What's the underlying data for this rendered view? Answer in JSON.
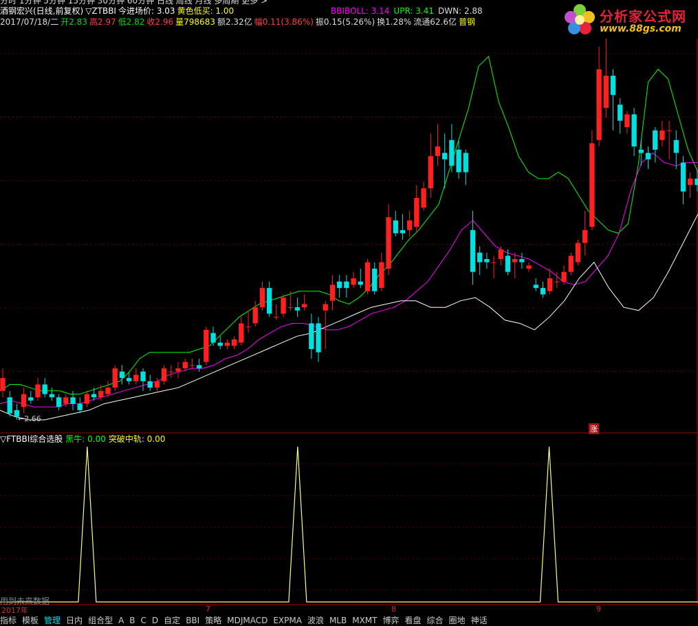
{
  "top_row": {
    "text": "分时 1分钟 5分钟 15分钟 30分钟 60分钟 日线 周线 月线 多周期 更多 >"
  },
  "title_row": [
    {
      "text": "酒钢宏兴(日线,前复权)",
      "color": "#ffffff"
    },
    {
      "text": "▽ZTBBI",
      "color": "#ffffff"
    },
    {
      "text": "今进场价: 3.03",
      "color": "#ffffff"
    },
    {
      "text": "黄色低买: 1.00",
      "color": "#ffff00"
    }
  ],
  "bbi_row": [
    {
      "text": "BBIBOLL: 3.14",
      "color": "#ff00ff"
    },
    {
      "text": "UPR: 3.41",
      "color": "#00ff00"
    },
    {
      "text": "DWN: 2.88",
      "color": "#dddddd"
    }
  ],
  "info_row": [
    {
      "text": "2017/07/18/二",
      "color": "#dddddd"
    },
    {
      "text": "开2.83",
      "color": "#00dd00"
    },
    {
      "text": "高2.97",
      "color": "#ff4040"
    },
    {
      "text": "低2.82",
      "color": "#00dd00"
    },
    {
      "text": "收2.96",
      "color": "#ff4040"
    },
    {
      "text": "量798683",
      "color": "#ffff00"
    },
    {
      "text": "额2.32亿",
      "color": "#dddddd"
    },
    {
      "text": "幅0.11(3.86%)",
      "color": "#ff4040"
    },
    {
      "text": "振0.15(5.26%)",
      "color": "#dddddd"
    },
    {
      "text": "换1.28%",
      "color": "#dddddd"
    },
    {
      "text": "流通62.6亿",
      "color": "#dddddd"
    },
    {
      "text": "普钢",
      "color": "#ffff00"
    }
  ],
  "logo": {
    "brand": "分析家公式网",
    "url": "www.88gs.com"
  },
  "low_marker": "←2.66",
  "zhang_badge": "涨",
  "sub_row": [
    {
      "text": "▽FTBBI综合选股",
      "color": "#ffffff"
    },
    {
      "text": "黑牛: 0.00",
      "color": "#00ff00"
    },
    {
      "text": "突破中轨: 0.00",
      "color": "#ffff00"
    }
  ],
  "future_notice": "用到未来数据",
  "time_axis": [
    "2017年",
    "7",
    "8",
    "9"
  ],
  "bottom_tabs": [
    "指标",
    "模板",
    "管理",
    "日内",
    "组合型",
    "A",
    "B",
    "C",
    "D",
    "自定",
    "BBI",
    "策略",
    "MDJMACD",
    "EXPMA",
    "波浪",
    "MLB",
    "MXMT",
    "博弈",
    "看盘",
    "综合",
    "圈地",
    "神话"
  ],
  "colors": {
    "up": "#ff2020",
    "down": "#00e0e0",
    "upper_band": "#00ff00",
    "mid_band": "#ff00ff",
    "lower_band": "#ffffff",
    "signal": "#ffff80",
    "grid": "#5a0000"
  },
  "chart_data": {
    "type": "candlestick",
    "price_range": [
      2.6,
      3.85
    ],
    "candles": [
      [
        2.72,
        2.76,
        2.79,
        2.7
      ],
      [
        2.7,
        2.65,
        2.72,
        2.64
      ],
      [
        2.66,
        2.64,
        2.68,
        2.63
      ],
      [
        2.67,
        2.71,
        2.73,
        2.65
      ],
      [
        2.7,
        2.69,
        2.72,
        2.68
      ],
      [
        2.7,
        2.74,
        2.76,
        2.69
      ],
      [
        2.74,
        2.71,
        2.76,
        2.7
      ],
      [
        2.71,
        2.7,
        2.73,
        2.69
      ],
      [
        2.7,
        2.67,
        2.71,
        2.66
      ],
      [
        2.68,
        2.7,
        2.71,
        2.67
      ],
      [
        2.7,
        2.68,
        2.72,
        2.66
      ],
      [
        2.68,
        2.66,
        2.7,
        2.65
      ],
      [
        2.68,
        2.71,
        2.72,
        2.67
      ],
      [
        2.71,
        2.7,
        2.73,
        2.69
      ],
      [
        2.7,
        2.72,
        2.74,
        2.69
      ],
      [
        2.71,
        2.73,
        2.75,
        2.7
      ],
      [
        2.73,
        2.79,
        2.8,
        2.72
      ],
      [
        2.78,
        2.76,
        2.8,
        2.74
      ],
      [
        2.76,
        2.75,
        2.78,
        2.74
      ],
      [
        2.75,
        2.77,
        2.79,
        2.74
      ],
      [
        2.78,
        2.75,
        2.79,
        2.72
      ],
      [
        2.75,
        2.73,
        2.77,
        2.72
      ],
      [
        2.73,
        2.75,
        2.76,
        2.72
      ],
      [
        2.75,
        2.79,
        2.8,
        2.74
      ],
      [
        2.78,
        2.78,
        2.8,
        2.76
      ],
      [
        2.78,
        2.79,
        2.81,
        2.76
      ],
      [
        2.79,
        2.81,
        2.82,
        2.78
      ],
      [
        2.8,
        2.8,
        2.82,
        2.79
      ],
      [
        2.8,
        2.79,
        2.82,
        2.78
      ],
      [
        2.81,
        2.91,
        2.92,
        2.8
      ],
      [
        2.9,
        2.87,
        2.92,
        2.86
      ],
      [
        2.87,
        2.86,
        2.89,
        2.85
      ],
      [
        2.86,
        2.87,
        2.88,
        2.85
      ],
      [
        2.86,
        2.88,
        2.89,
        2.85
      ],
      [
        2.87,
        2.93,
        2.95,
        2.86
      ],
      [
        2.92,
        2.92,
        2.97,
        2.9
      ],
      [
        2.93,
        2.98,
        3.0,
        2.92
      ],
      [
        2.98,
        3.04,
        3.06,
        2.97
      ],
      [
        3.04,
        2.96,
        3.06,
        2.95
      ],
      [
        2.95,
        2.95,
        2.99,
        2.94
      ],
      [
        2.96,
        3.01,
        3.02,
        2.95
      ],
      [
        2.98,
        2.98,
        3.03,
        2.97
      ],
      [
        2.98,
        2.97,
        3.01,
        2.95
      ],
      [
        2.98,
        2.99,
        3.02,
        2.97
      ],
      [
        2.93,
        2.85,
        2.96,
        2.82
      ],
      [
        2.93,
        2.84,
        2.95,
        2.81
      ],
      [
        2.97,
        2.99,
        3.0,
        2.85
      ],
      [
        3.0,
        3.05,
        3.08,
        2.97
      ],
      [
        3.06,
        3.04,
        3.08,
        3.01
      ],
      [
        3.06,
        3.04,
        3.08,
        3.01
      ],
      [
        3.05,
        3.07,
        3.09,
        3.04
      ],
      [
        3.06,
        3.05,
        3.1,
        3.04
      ],
      [
        3.03,
        3.12,
        3.13,
        3.02
      ],
      [
        3.1,
        3.03,
        3.12,
        3.02
      ],
      [
        3.04,
        3.12,
        3.15,
        3.03
      ],
      [
        3.1,
        3.26,
        3.3,
        3.08
      ],
      [
        3.25,
        3.21,
        3.28,
        3.2
      ],
      [
        3.22,
        3.21,
        3.27,
        3.19
      ],
      [
        3.22,
        3.25,
        3.28,
        3.2
      ],
      [
        3.23,
        3.32,
        3.36,
        3.21
      ],
      [
        3.29,
        3.35,
        3.37,
        3.28
      ],
      [
        3.35,
        3.45,
        3.52,
        3.32
      ],
      [
        3.45,
        3.48,
        3.55,
        3.42
      ],
      [
        3.46,
        3.44,
        3.52,
        3.35
      ],
      [
        3.5,
        3.42,
        3.55,
        3.4
      ],
      [
        3.47,
        3.4,
        3.5,
        3.38
      ],
      [
        3.46,
        3.4,
        3.47,
        3.36
      ],
      [
        3.22,
        3.09,
        3.28,
        3.05
      ],
      [
        3.15,
        3.12,
        3.17,
        3.08
      ],
      [
        3.13,
        3.12,
        3.15,
        3.1
      ],
      [
        3.12,
        3.12,
        3.14,
        3.07
      ],
      [
        3.13,
        3.16,
        3.17,
        3.11
      ],
      [
        3.14,
        3.09,
        3.16,
        3.08
      ],
      [
        3.12,
        3.13,
        3.15,
        3.07
      ],
      [
        3.13,
        3.12,
        3.15,
        3.1
      ],
      [
        3.1,
        3.11,
        3.12,
        3.09
      ],
      [
        3.05,
        3.04,
        3.07,
        3.03
      ],
      [
        3.04,
        3.02,
        3.06,
        3.01
      ],
      [
        3.03,
        3.07,
        3.1,
        3.02
      ],
      [
        3.06,
        3.06,
        3.09,
        3.04
      ],
      [
        3.06,
        3.09,
        3.11,
        3.05
      ],
      [
        3.09,
        3.14,
        3.15,
        3.08
      ],
      [
        3.12,
        3.18,
        3.19,
        3.11
      ],
      [
        3.18,
        3.22,
        3.28,
        3.14
      ],
      [
        3.23,
        3.49,
        3.53,
        3.22
      ],
      [
        3.5,
        3.72,
        3.79,
        3.48
      ],
      [
        3.6,
        3.7,
        3.82,
        3.57
      ],
      [
        3.7,
        3.64,
        3.72,
        3.53
      ],
      [
        3.61,
        3.56,
        3.63,
        3.52
      ],
      [
        3.54,
        3.58,
        3.59,
        3.52
      ],
      [
        3.58,
        3.48,
        3.6,
        3.45
      ],
      [
        3.47,
        3.46,
        3.5,
        3.42
      ],
      [
        3.46,
        3.44,
        3.48,
        3.41
      ],
      [
        3.53,
        3.47,
        3.54,
        3.43
      ],
      [
        3.5,
        3.53,
        3.56,
        3.48
      ],
      [
        3.53,
        3.53,
        3.56,
        3.44
      ],
      [
        3.5,
        3.46,
        3.53,
        3.41
      ],
      [
        3.43,
        3.34,
        3.45,
        3.3
      ],
      [
        3.36,
        3.38,
        3.4,
        3.32
      ],
      [
        3.38,
        3.36,
        3.41,
        3.34
      ]
    ],
    "upper_band": [
      2.72,
      2.74,
      2.74,
      2.73,
      2.72,
      2.72,
      2.72,
      2.71,
      2.71,
      2.72,
      2.73,
      2.74,
      2.75,
      2.78,
      2.82,
      2.84,
      2.84,
      2.84,
      2.84,
      2.84,
      2.85,
      2.86,
      2.89,
      2.92,
      2.95,
      2.97,
      2.99,
      3.0,
      3.01,
      3.02,
      3.03,
      3.03,
      3.03,
      3.02,
      3.0,
      2.99,
      3.01,
      3.04,
      3.08,
      3.11,
      3.15,
      3.19,
      3.22,
      3.26,
      3.3,
      3.4,
      3.5,
      3.6,
      3.73,
      3.76,
      3.62,
      3.54,
      3.45,
      3.4,
      3.38,
      3.38,
      3.4,
      3.38,
      3.33,
      3.28,
      3.25,
      3.22,
      3.21,
      3.24,
      3.42,
      3.68,
      3.72,
      3.69,
      3.58,
      3.47,
      3.4
    ],
    "mid_band": [
      2.68,
      2.69,
      2.68,
      2.67,
      2.67,
      2.67,
      2.68,
      2.68,
      2.69,
      2.7,
      2.71,
      2.72,
      2.73,
      2.74,
      2.75,
      2.77,
      2.78,
      2.79,
      2.79,
      2.8,
      2.82,
      2.83,
      2.85,
      2.88,
      2.9,
      2.92,
      2.93,
      2.93,
      2.92,
      2.91,
      2.91,
      2.92,
      2.94,
      2.96,
      2.97,
      2.98,
      3.0,
      3.03,
      3.06,
      3.11,
      3.16,
      3.22,
      3.25,
      3.21,
      3.17,
      3.15,
      3.14,
      3.13,
      3.11,
      3.09,
      3.06,
      3.05,
      3.06,
      3.1,
      3.14,
      3.21,
      3.34,
      3.43,
      3.46,
      3.43,
      3.42,
      3.43,
      3.43
    ],
    "lower_band": [
      2.66,
      2.64,
      2.63,
      2.63,
      2.64,
      2.65,
      2.66,
      2.68,
      2.69,
      2.7,
      2.71,
      2.72,
      2.73,
      2.75,
      2.77,
      2.79,
      2.81,
      2.83,
      2.85,
      2.87,
      2.89,
      2.9,
      2.92,
      2.94,
      2.96,
      2.98,
      2.99,
      3.0,
      3.0,
      2.98,
      2.98,
      3.0,
      3.01,
      2.98,
      2.94,
      2.93,
      2.91,
      2.95,
      3.0,
      3.07,
      3.12,
      3.04,
      2.98,
      2.97,
      3.01,
      3.09,
      3.18,
      3.27
    ]
  },
  "signal_chart": {
    "type": "line",
    "range": [
      0,
      1
    ],
    "spikes": [
      {
        "bar": 17,
        "value": 1
      },
      {
        "bar": 58,
        "value": 1
      },
      {
        "bar": 107,
        "value": 1
      }
    ]
  }
}
